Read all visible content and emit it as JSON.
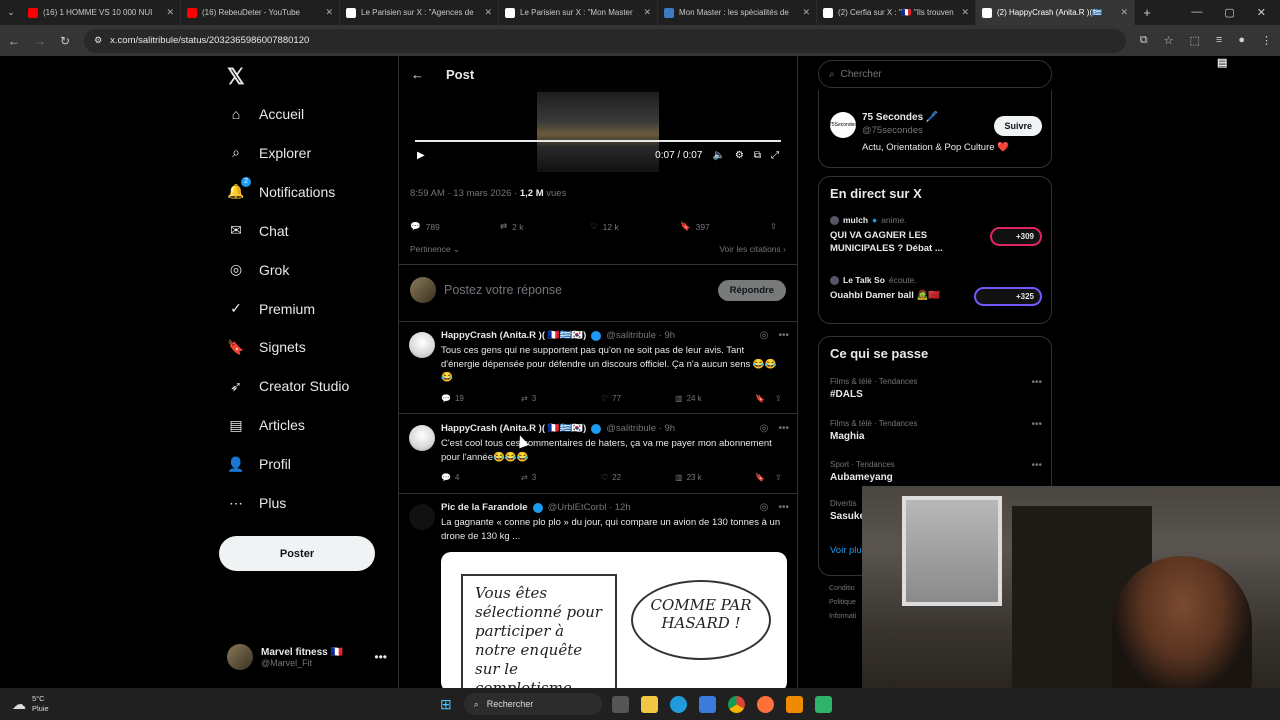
{
  "browser": {
    "tabs": [
      {
        "title": "(16) 1 HOMME VS 10 000 NUI",
        "color": "#ff0000",
        "active": false
      },
      {
        "title": "(16) RebeuDeter - YouTube",
        "color": "#ff0000",
        "active": false
      },
      {
        "title": "Le Parisien sur X : \"Agences de",
        "color": "#ffffff",
        "active": false
      },
      {
        "title": "Le Parisien sur X : \"Mon Master",
        "color": "#ffffff",
        "active": false
      },
      {
        "title": "Mon Master : les spécialités de",
        "color": "#3b7bbf",
        "active": false
      },
      {
        "title": "(2) Cerfia sur X : \"🇫🇷 \"Ils trouven",
        "color": "#ffffff",
        "active": false
      },
      {
        "title": "(2) HappyCrash (Anita.R )(🇬🇷",
        "color": "#ffffff",
        "active": true
      }
    ],
    "url": "x.com/salitribule/status/2032365986007880120"
  },
  "nav": {
    "items": [
      {
        "label": "Accueil",
        "icon": "home-icon"
      },
      {
        "label": "Explorer",
        "icon": "search-icon"
      },
      {
        "label": "Notifications",
        "icon": "bell-icon",
        "badge": "2"
      },
      {
        "label": "Chat",
        "icon": "mail-icon"
      },
      {
        "label": "Grok",
        "icon": "grok-icon"
      },
      {
        "label": "Premium",
        "icon": "verified-icon"
      },
      {
        "label": "Signets",
        "icon": "bookmark-icon"
      },
      {
        "label": "Creator Studio",
        "icon": "rocket-icon"
      },
      {
        "label": "Articles",
        "icon": "article-icon"
      },
      {
        "label": "Profil",
        "icon": "person-icon"
      },
      {
        "label": "Plus",
        "icon": "more-circle-icon"
      }
    ],
    "post_label": "Poster",
    "me": {
      "name": "Marvel fitness 🇫🇷",
      "handle": "@Marvel_Fit"
    }
  },
  "post": {
    "header": "Post",
    "video_time": "0:07 / 0:07",
    "meta_date": "8:59 AM · 13 mars 2026 · ",
    "meta_views": "1,2 M",
    "meta_views_suffix": " vues",
    "stats": {
      "replies": "789",
      "reposts": "2 k",
      "likes": "12 k",
      "bookmarks": "397"
    },
    "sort_label": "Pertinence",
    "quotes_label": "Voir les citations",
    "reply_placeholder": "Postez votre réponse",
    "reply_button": "Répondre"
  },
  "replies": [
    {
      "name": "HappyCrash (Anita.R )( 🇫🇷🇬🇷🇰🇷)",
      "handle": "@salitribule · 9h",
      "text": "Tous ces gens qui ne supportent pas qu'on ne soit pas de leur avis. Tant d'énergie dépensée pour défendre un discours officiel. Ça n'a aucun sens 😂😂😂",
      "replies": "19",
      "reposts": "3",
      "likes": "77",
      "views": "24 k"
    },
    {
      "name": "HappyCrash (Anita.R )( 🇫🇷🇬🇷🇰🇷)",
      "handle": "@salitribule · 9h",
      "text": "C'est cool tous ces commentaires de haters, ça va me payer mon abonnement pour l'année😂😂😂",
      "replies": "4",
      "reposts": "3",
      "likes": "22",
      "views": "23 k"
    },
    {
      "name": "Pic de la Farandole",
      "handle": "@UrblEtCorbl · 12h",
      "text": "La gagnante « conne plo plo » du jour, qui compare un avion de 130 tonnes à un drone de 130 kg ..."
    }
  ],
  "cartoon": {
    "panel_text": "Vous êtes sélectionné pour participer à notre enquête sur le complotisme",
    "bubble_text": "COMME PAR HASARD !"
  },
  "sidebar": {
    "search_placeholder": "Chercher",
    "follow": {
      "name": "75 Secondes 🖊️",
      "handle": "@75secondes",
      "desc": "Actu, Orientation & Pop Culture ❤️",
      "button": "Suivre",
      "avatar_text": "75Secondes"
    },
    "live_title": "En direct sur X",
    "live": [
      {
        "host": "mulch",
        "action": "anime.",
        "title": "QUI VA GAGNER LES MUNICIPALES ? Débat ...",
        "count": "+309"
      },
      {
        "host": "Le Talk So",
        "action": "écoute.",
        "title": "Ouahbi Damer ball 🧟🇲🇦",
        "count": "+325"
      }
    ],
    "trends_title": "Ce qui se passe",
    "trends": [
      {
        "category": "Films & télé · Tendances",
        "topic": "#DALS"
      },
      {
        "category": "Films & télé · Tendances",
        "topic": "Maghia"
      },
      {
        "category": "Sport · Tendances",
        "topic": "Aubameyang"
      },
      {
        "category": "Divertis",
        "topic": "Sasuke"
      }
    ],
    "see_more": "Voir plu",
    "footer": [
      "Conditio",
      "Politique",
      "Informati"
    ]
  },
  "taskbar": {
    "temp": "5°C",
    "condition": "Pluie",
    "search": "Rechercher"
  }
}
